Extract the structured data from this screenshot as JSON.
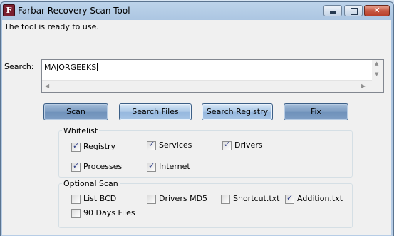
{
  "window": {
    "title": "Farbar Recovery Scan Tool",
    "icon_letter": "F",
    "controls": {
      "minimize": "minimize",
      "maximize": "maximize",
      "close": "✕"
    }
  },
  "status": "The tool is ready to use.",
  "search": {
    "label": "Search:",
    "value": "MAJORGEEKS"
  },
  "buttons": {
    "scan": "Scan",
    "search_files": "Search Files",
    "search_registry": "Search Registry",
    "fix": "Fix"
  },
  "whitelist": {
    "label": "Whitelist",
    "items": [
      {
        "label": "Registry",
        "checked": true
      },
      {
        "label": "Services",
        "checked": true
      },
      {
        "label": "Drivers",
        "checked": true
      },
      {
        "label": "Processes",
        "checked": true
      },
      {
        "label": "Internet",
        "checked": true
      }
    ]
  },
  "optional_scan": {
    "label": "Optional Scan",
    "items": [
      {
        "label": "List BCD",
        "checked": false
      },
      {
        "label": "Drivers MD5",
        "checked": false
      },
      {
        "label": "Shortcut.txt",
        "checked": false
      },
      {
        "label": "Addition.txt",
        "checked": true
      },
      {
        "label": "90 Days Files",
        "checked": false
      }
    ]
  },
  "colors": {
    "frame": "#b7cde6",
    "client": "#f0f0f0",
    "accent_button": "#7c9cc2",
    "button": "#a9c6e6",
    "close_button": "#c75a44"
  }
}
